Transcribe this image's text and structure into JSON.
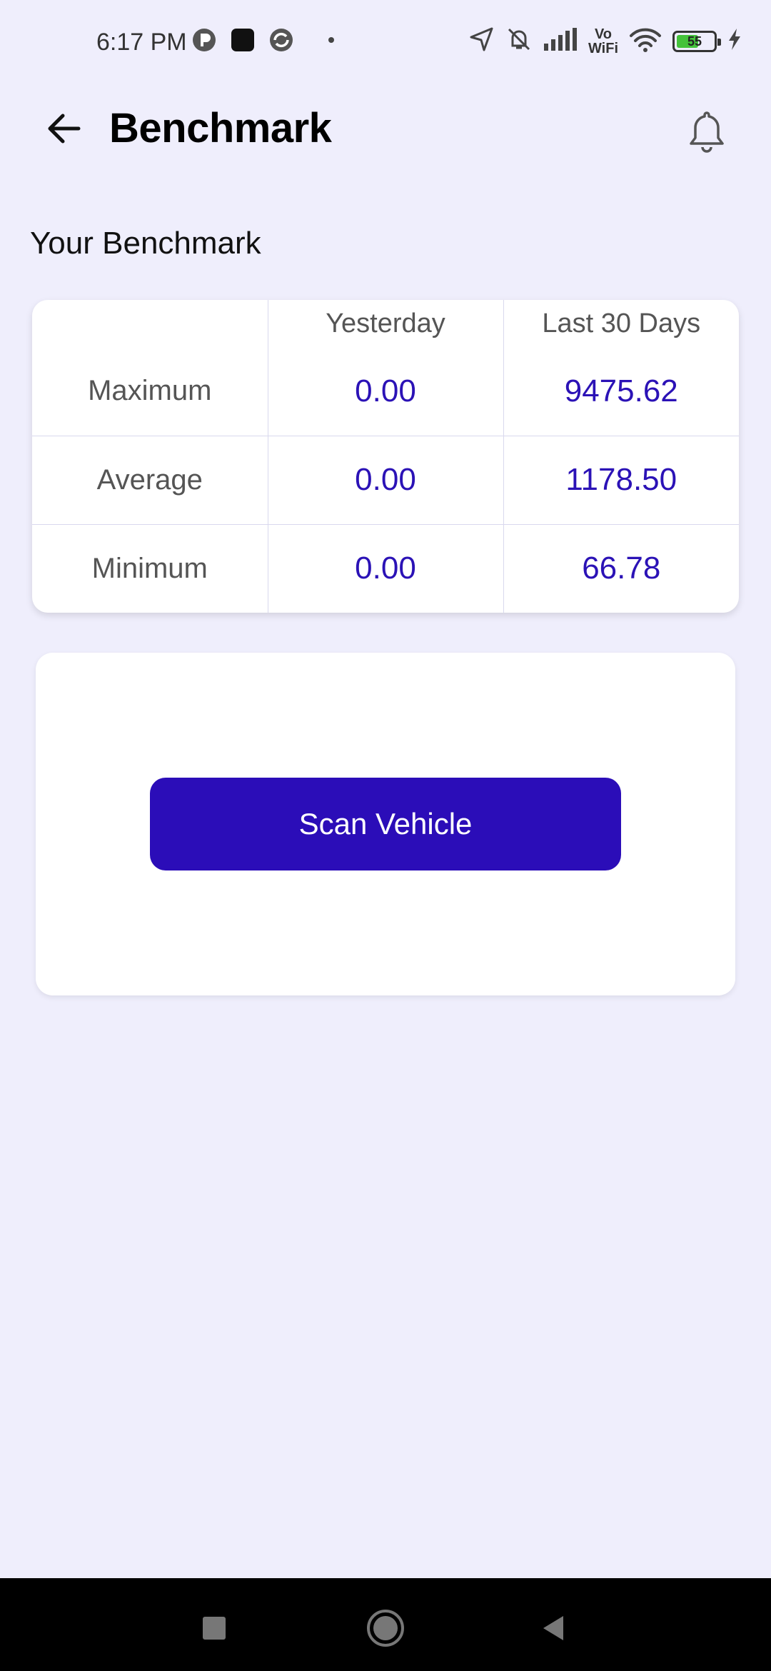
{
  "status_bar": {
    "time": "6:17 PM",
    "vowifi_top": "Vo",
    "vowifi_bottom": "WiFi",
    "battery_level": "55",
    "icons": [
      "app-icon-1",
      "app-icon-2",
      "app-icon-3",
      "location-icon",
      "mute-icon",
      "signal-icon",
      "wifi-icon",
      "battery-icon",
      "charging-icon"
    ]
  },
  "header": {
    "title": "Benchmark",
    "back_icon": "arrow-left-icon",
    "notification_icon": "bell-icon"
  },
  "benchmark": {
    "section_title": "Your Benchmark",
    "columns": [
      "",
      "Yesterday",
      "Last 30 Days"
    ],
    "rows": [
      {
        "label": "Maximum",
        "yesterday": "0.00",
        "last30": "9475.62"
      },
      {
        "label": "Average",
        "yesterday": "0.00",
        "last30": "1178.50"
      },
      {
        "label": "Minimum",
        "yesterday": "0.00",
        "last30": "66.78"
      }
    ]
  },
  "scan": {
    "button_label": "Scan Vehicle"
  },
  "colors": {
    "background": "#efeefc",
    "accent": "#2b0db8",
    "value_text": "#2b12b6"
  },
  "nav_bar": {
    "icons": [
      "recents-square-icon",
      "home-circle-icon",
      "back-triangle-icon"
    ]
  }
}
